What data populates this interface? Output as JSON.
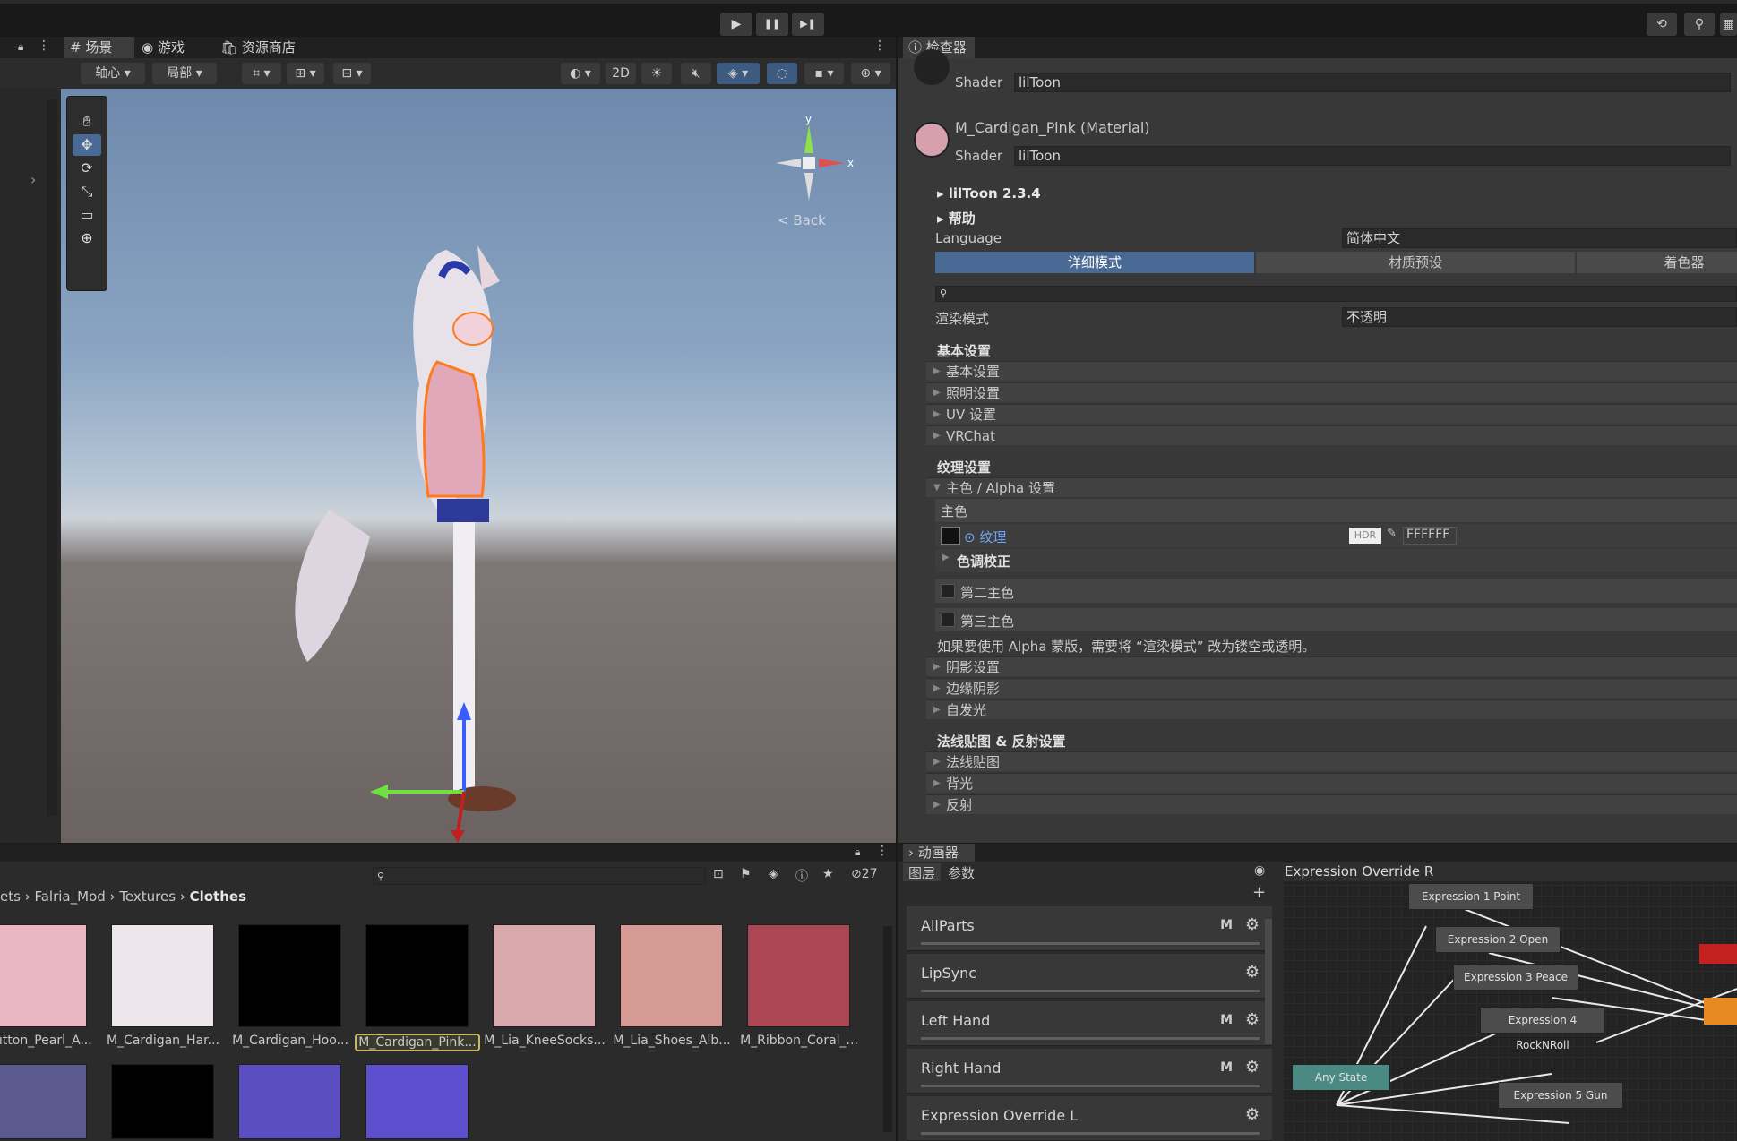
{
  "toolbar": {
    "play": "▶",
    "pause": "❚❚",
    "step": "▶❚",
    "history_icon": "⟲",
    "search_icon": "⚲"
  },
  "scene": {
    "tabs": [
      "场景",
      "游戏",
      "资源商店"
    ],
    "pivot": "轴心",
    "local": "局部",
    "mode_2d": "2D",
    "back_label": "Back",
    "axis_y": "y",
    "axis_x": "x"
  },
  "inspector": {
    "tab": "检查器",
    "prev_shader_label": "Shader",
    "prev_shader_value": "lilToon",
    "material_name": "M_Cardigan_Pink (Material)",
    "shader_label": "Shader",
    "shader_value": "lilToon",
    "version": "lilToon 2.3.4",
    "help": "帮助",
    "language_label": "Language",
    "language_value": "简体中文",
    "mode_tabs": [
      "详细模式",
      "材质预设",
      "着色器"
    ],
    "render_mode_label": "渲染模式",
    "render_mode_value": "不透明",
    "basic_header": "基本设置",
    "basic_items": [
      "基本设置",
      "照明设置",
      "UV 设置",
      "VRChat"
    ],
    "texture_header": "纹理设置",
    "main_alpha": "主色 / Alpha 设置",
    "main_color": "主色",
    "texture_label": "纹理",
    "hdr": "HDR",
    "color_hex": "FFFFFF",
    "tone_correction": "色调校正",
    "second_color": "第二主色",
    "third_color": "第三主色",
    "alpha_note": "如果要使用 Alpha 蒙版，需要将 “渲染模式” 改为镂空或透明。",
    "more_items": [
      "阴影设置",
      "边缘阴影",
      "自发光"
    ],
    "normal_header": "法线贴图 & 反射设置",
    "normal_items": [
      "法线贴图",
      "背光",
      "反射"
    ]
  },
  "project": {
    "breadcrumb": [
      "ets",
      "Falria_Mod",
      "Textures",
      "Clothes"
    ],
    "hidden_count": "27",
    "assets": [
      {
        "label": "_Button_Pearl_A...",
        "color": "#e9b5c3"
      },
      {
        "label": "M_Cardigan_Har...",
        "color": "#ede6ea"
      },
      {
        "label": "M_Cardigan_Hoo...",
        "color": "#000000"
      },
      {
        "label": "M_Cardigan_Pink...",
        "color": "#000000"
      },
      {
        "label": "M_Lia_KneeSocks...",
        "color": "#d9a8ac"
      },
      {
        "label": "M_Lia_Shoes_Alb...",
        "color": "#d49a93"
      },
      {
        "label": "M_Ribbon_Coral_...",
        "color": "#ad4654"
      }
    ],
    "row2_colors": [
      "#5a5a8e",
      "#000000",
      "#5a4ec0",
      "#5e4fcf"
    ]
  },
  "animator": {
    "tab": "动画器",
    "sub_tabs": [
      "图层",
      "参数"
    ],
    "graph_title": "Expression Override R",
    "layers": [
      {
        "name": "AllParts",
        "m": "M"
      },
      {
        "name": "LipSync",
        "m": ""
      },
      {
        "name": "Left Hand",
        "m": "M"
      },
      {
        "name": "Right Hand",
        "m": "M"
      },
      {
        "name": "Expression Override L",
        "m": ""
      }
    ],
    "nodes": [
      "Expression 1 Point",
      "Expression 2 Open",
      "Expression 3 Peace",
      "Expression 4 RockNRoll",
      "Any State",
      "Expression 5 Gun"
    ]
  }
}
